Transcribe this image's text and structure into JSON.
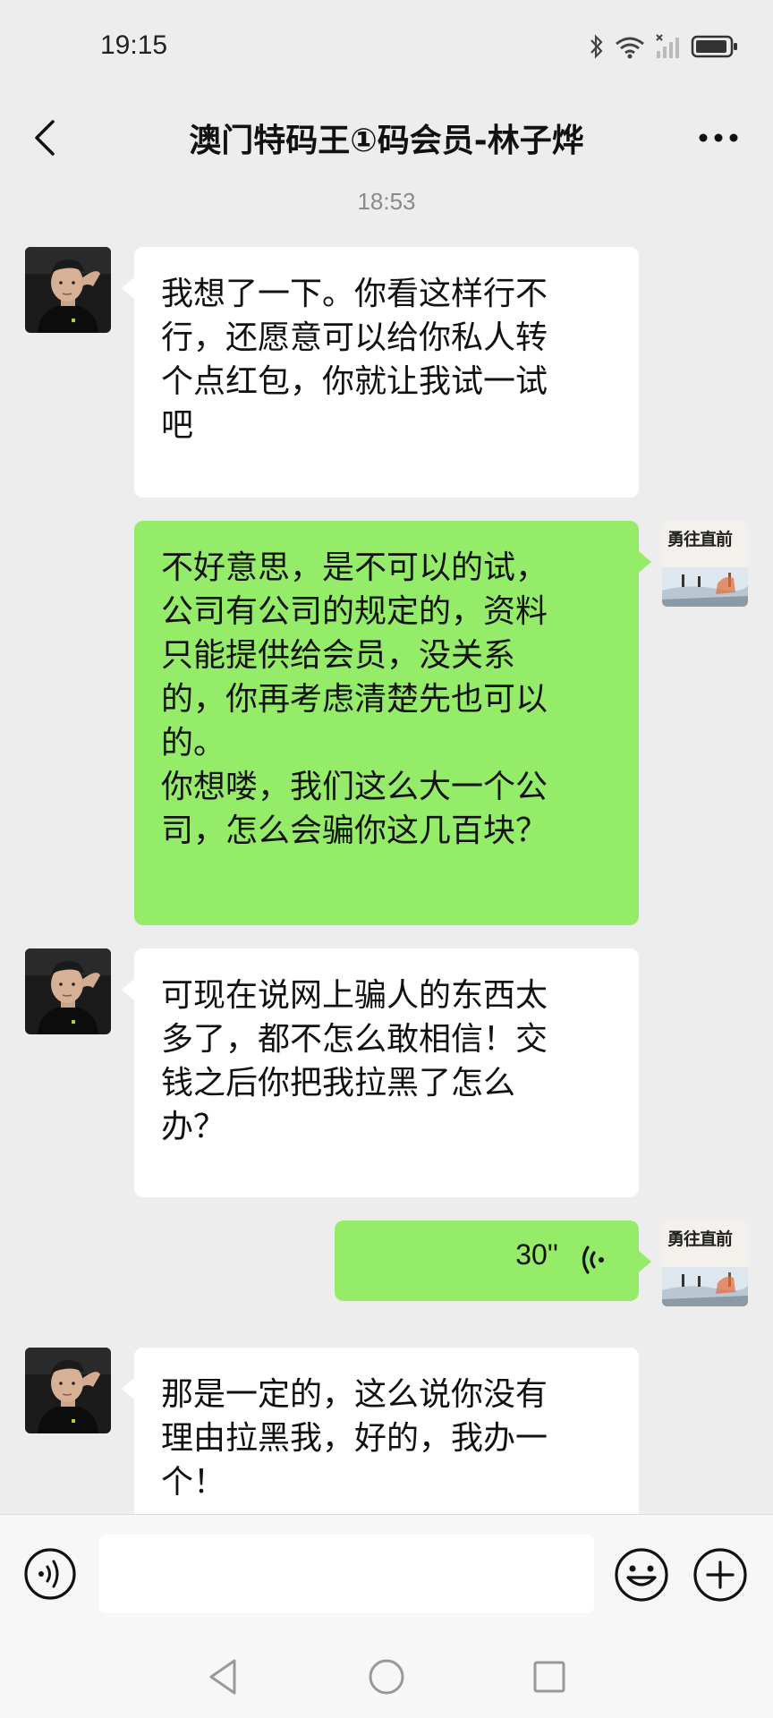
{
  "status_bar": {
    "time": "19:15"
  },
  "header": {
    "title": "澳门特码王①码会员-林子烨"
  },
  "timestamp": "18:53",
  "messages": [
    {
      "side": "in",
      "text": "我想了一下。你看这样行不\n行，还愿意可以给你私人转\n个点红包，你就让我试一试\n吧"
    },
    {
      "side": "out",
      "text": "不好意思，是不可以的试，\n公司有公司的规定的，资料\n只能提供给会员，没关系\n的，你再考虑清楚先也可以\n的。\n你想喽，我们这么大一个公\n司，怎么会骗你这几百块？"
    },
    {
      "side": "in",
      "text": "可现在说网上骗人的东西太\n多了，都不怎么敢相信！交\n钱之后你把我拉黑了怎么\n办？"
    },
    {
      "side": "out",
      "type": "voice",
      "duration": "30''"
    },
    {
      "side": "in",
      "text": "那是一定的，这么说你没有\n理由拉黑我，好的，我办一\n个！"
    }
  ],
  "my_avatar_text": "勇往直前",
  "input": {
    "value": "",
    "placeholder": ""
  },
  "colors": {
    "background": "#ededed",
    "bubble_out": "#95ec69",
    "bubble_in": "#ffffff"
  }
}
